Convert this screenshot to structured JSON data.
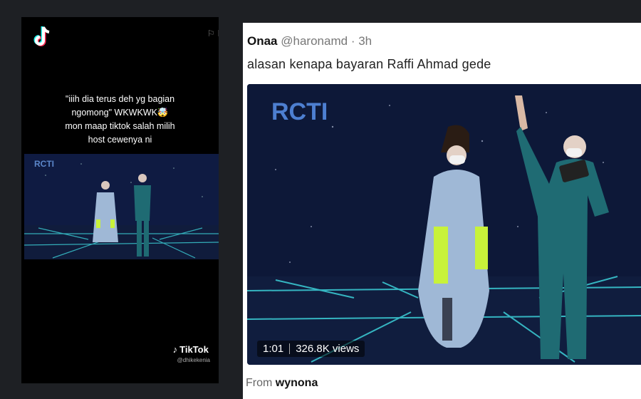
{
  "tiktok": {
    "caption": [
      "\"iiih dia terus deh yg bagian",
      "ngomong\" WKWKWK🤯",
      "mon maap tiktok salah milih",
      "host cewenya ni"
    ],
    "video_logo": "RCTI",
    "watermark_brand": "TikTok",
    "watermark_user": "@dhikekenia",
    "icons": [
      "tiktok-logo-icon",
      "flag-icon"
    ]
  },
  "tweet": {
    "name": "Onaa",
    "handle": "@haronamd",
    "time": "3h",
    "separator": "·",
    "text": "alasan kenapa bayaran Raffi Ahmad gede",
    "media": {
      "channel_logo": "RCTI",
      "duration": "1:01",
      "views": "326.8K views"
    },
    "from_label": "From",
    "from_user": "wynona"
  },
  "colors": {
    "background": "#1e2024",
    "stage": "#0e1a3a",
    "accent_lime": "#c8f23a",
    "dress": "#9fb8d6",
    "suit": "#1f6b73"
  }
}
